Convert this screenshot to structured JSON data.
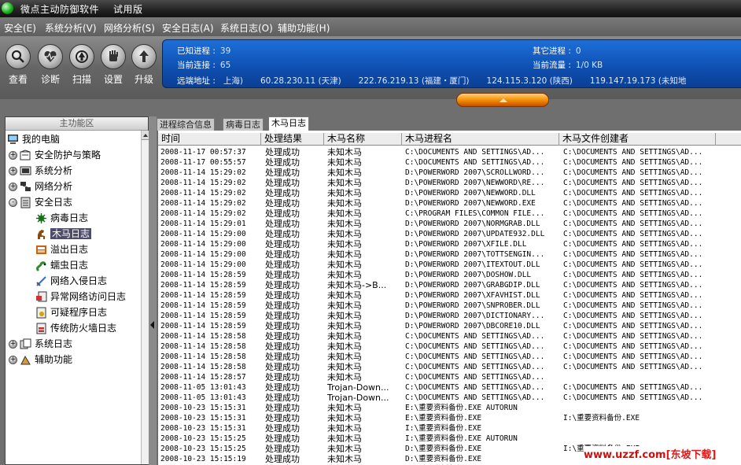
{
  "title": {
    "app_name": "微点主动防御软件",
    "edition": "试用版"
  },
  "menu": [
    "安全(E)",
    "系统分析(V)",
    "网络分析(S)",
    "安全日志(A)",
    "系统日志(O)",
    "辅助功能(H)"
  ],
  "toolbar": {
    "buttons": [
      {
        "label": "查看",
        "icon": "magnifier-icon"
      },
      {
        "label": "诊断",
        "icon": "heart-monitor-icon"
      },
      {
        "label": "扫描",
        "icon": "scan-icon"
      },
      {
        "label": "设置",
        "icon": "hand-icon"
      },
      {
        "label": "升级",
        "icon": "upgrade-icon"
      }
    ]
  },
  "info": {
    "known_processes_label": "已知进程 :",
    "known_processes": "39",
    "other_processes_label": "其它进程 :",
    "other_processes": "0",
    "connections_label": "当前连接 :",
    "connections": "65",
    "traffic_label": "当前流量 :",
    "traffic": "1/0 KB",
    "remote_label": "远端地址 :",
    "remote_addresses": [
      "上海)",
      "60.28.230.11 (天津)",
      "222.76.219.13 (福建・厦门)",
      "124.115.3.120 (陕西)",
      "119.147.19.173 (未知地"
    ]
  },
  "left_panel": {
    "header": "主功能区",
    "tree": [
      {
        "label": "我的电脑",
        "icon": "computer-icon",
        "level": 0,
        "expander": ""
      },
      {
        "label": "安全防护与策略",
        "icon": "shield-policy-icon",
        "level": 1,
        "expander": "+"
      },
      {
        "label": "系统分析",
        "icon": "system-icon",
        "level": 1,
        "expander": "+"
      },
      {
        "label": "网络分析",
        "icon": "network-icon",
        "level": 1,
        "expander": "+"
      },
      {
        "label": "安全日志",
        "icon": "log-icon",
        "level": 1,
        "expander": "-"
      },
      {
        "label": "病毒日志",
        "icon": "virus-icon",
        "level": 2,
        "expander": ""
      },
      {
        "label": "木马日志",
        "icon": "trojan-horse-icon",
        "level": 2,
        "expander": "",
        "selected": true
      },
      {
        "label": "溢出日志",
        "icon": "overflow-icon",
        "level": 2,
        "expander": ""
      },
      {
        "label": "蠕虫日志",
        "icon": "worm-icon",
        "level": 2,
        "expander": ""
      },
      {
        "label": "网络入侵日志",
        "icon": "sword-icon",
        "level": 2,
        "expander": ""
      },
      {
        "label": "异常网络访问日志",
        "icon": "network-log-icon",
        "level": 2,
        "expander": ""
      },
      {
        "label": "可疑程序日志",
        "icon": "suspicious-icon",
        "level": 2,
        "expander": ""
      },
      {
        "label": "传统防火墙日志",
        "icon": "firewall-icon",
        "level": 2,
        "expander": ""
      },
      {
        "label": "系统日志",
        "icon": "system-log-icon",
        "level": 1,
        "expander": "+"
      },
      {
        "label": "辅助功能",
        "icon": "tools-icon",
        "level": 1,
        "expander": "+"
      }
    ]
  },
  "tabs": [
    "进程综合信息",
    "病毒日志",
    "木马日志"
  ],
  "active_tab": 2,
  "table": {
    "columns": [
      "时间",
      "处理结果",
      "木马名称",
      "木马进程名",
      "木马文件创建者"
    ],
    "rows": [
      [
        "2008-11-17 00:57:37",
        "处理成功",
        "未知木马",
        "C:\\DOCUMENTS AND SETTINGS\\AD...",
        "C:\\DOCUMENTS AND SETTINGS\\AD..."
      ],
      [
        "2008-11-17 00:55:57",
        "处理成功",
        "未知木马",
        "C:\\DOCUMENTS AND SETTINGS\\AD...",
        "C:\\DOCUMENTS AND SETTINGS\\AD..."
      ],
      [
        "2008-11-14 15:29:02",
        "处理成功",
        "未知木马",
        "D:\\POWERWORD 2007\\SCROLLWORD...",
        "C:\\DOCUMENTS AND SETTINGS\\AD..."
      ],
      [
        "2008-11-14 15:29:02",
        "处理成功",
        "未知木马",
        "D:\\POWERWORD 2007\\NEWWORD\\RE...",
        "C:\\DOCUMENTS AND SETTINGS\\AD..."
      ],
      [
        "2008-11-14 15:29:02",
        "处理成功",
        "未知木马",
        "D:\\POWERWORD 2007\\NEWWORD.DLL",
        "C:\\DOCUMENTS AND SETTINGS\\AD..."
      ],
      [
        "2008-11-14 15:29:02",
        "处理成功",
        "未知木马",
        "D:\\POWERWORD 2007\\NEWWORD.EXE",
        "C:\\DOCUMENTS AND SETTINGS\\AD..."
      ],
      [
        "2008-11-14 15:29:02",
        "处理成功",
        "未知木马",
        "C:\\PROGRAM FILES\\COMMON FILE...",
        "C:\\DOCUMENTS AND SETTINGS\\AD..."
      ],
      [
        "2008-11-14 15:29:01",
        "处理成功",
        "未知木马",
        "D:\\POWERWORD 2007\\NORMGRAB.DLL",
        "C:\\DOCUMENTS AND SETTINGS\\AD..."
      ],
      [
        "2008-11-14 15:29:00",
        "处理成功",
        "未知木马",
        "D:\\POWERWORD 2007\\UPDATE932.DLL",
        "C:\\DOCUMENTS AND SETTINGS\\AD..."
      ],
      [
        "2008-11-14 15:29:00",
        "处理成功",
        "未知木马",
        "D:\\POWERWORD 2007\\XFILE.DLL",
        "C:\\DOCUMENTS AND SETTINGS\\AD..."
      ],
      [
        "2008-11-14 15:29:00",
        "处理成功",
        "未知木马",
        "D:\\POWERWORD 2007\\TOTTSENGIN...",
        "C:\\DOCUMENTS AND SETTINGS\\AD..."
      ],
      [
        "2008-11-14 15:29:00",
        "处理成功",
        "未知木马",
        "D:\\POWERWORD 2007\\ITEXTOUT.DLL",
        "C:\\DOCUMENTS AND SETTINGS\\AD..."
      ],
      [
        "2008-11-14 15:28:59",
        "处理成功",
        "未知木马",
        "D:\\POWERWORD 2007\\DOSHOW.DLL",
        "C:\\DOCUMENTS AND SETTINGS\\AD..."
      ],
      [
        "2008-11-14 15:28:59",
        "处理成功",
        "未知木马->B...",
        "D:\\POWERWORD 2007\\GRABGDIP.DLL",
        "C:\\DOCUMENTS AND SETTINGS\\AD..."
      ],
      [
        "2008-11-14 15:28:59",
        "处理成功",
        "未知木马",
        "D:\\POWERWORD 2007\\XFAVHIST.DLL",
        "C:\\DOCUMENTS AND SETTINGS\\AD..."
      ],
      [
        "2008-11-14 15:28:59",
        "处理成功",
        "未知木马",
        "D:\\POWERWORD 2007\\SNPROBER.DLL",
        "C:\\DOCUMENTS AND SETTINGS\\AD..."
      ],
      [
        "2008-11-14 15:28:59",
        "处理成功",
        "未知木马",
        "D:\\POWERWORD 2007\\DICTIONARY...",
        "C:\\DOCUMENTS AND SETTINGS\\AD..."
      ],
      [
        "2008-11-14 15:28:59",
        "处理成功",
        "未知木马",
        "D:\\POWERWORD 2007\\DBCORE10.DLL",
        "C:\\DOCUMENTS AND SETTINGS\\AD..."
      ],
      [
        "2008-11-14 15:28:58",
        "处理成功",
        "未知木马",
        "C:\\DOCUMENTS AND SETTINGS\\AD...",
        "C:\\DOCUMENTS AND SETTINGS\\AD..."
      ],
      [
        "2008-11-14 15:28:58",
        "处理成功",
        "未知木马",
        "C:\\DOCUMENTS AND SETTINGS\\AD...",
        "C:\\DOCUMENTS AND SETTINGS\\AD..."
      ],
      [
        "2008-11-14 15:28:58",
        "处理成功",
        "未知木马",
        "C:\\DOCUMENTS AND SETTINGS\\AD...",
        "C:\\DOCUMENTS AND SETTINGS\\AD..."
      ],
      [
        "2008-11-14 15:28:58",
        "处理成功",
        "未知木马",
        "C:\\DOCUMENTS AND SETTINGS\\AD...",
        "C:\\DOCUMENTS AND SETTINGS\\AD..."
      ],
      [
        "2008-11-14 15:28:57",
        "处理成功",
        "未知木马",
        "C:\\DOCUMENTS AND SETTINGS\\AD...",
        ""
      ],
      [
        "2008-11-05 13:01:43",
        "处理成功",
        "Trojan-Down...",
        "C:\\DOCUMENTS AND SETTINGS\\AD...",
        "C:\\DOCUMENTS AND SETTINGS\\AD..."
      ],
      [
        "2008-11-05 13:01:43",
        "处理成功",
        "Trojan-Down...",
        "C:\\DOCUMENTS AND SETTINGS\\AD...",
        "C:\\DOCUMENTS AND SETTINGS\\AD..."
      ],
      [
        "2008-10-23 15:15:31",
        "处理成功",
        "未知木马",
        "E:\\重要资料备份.EXE AUTORUN",
        ""
      ],
      [
        "2008-10-23 15:15:31",
        "处理成功",
        "未知木马",
        "E:\\重要资料备份.EXE",
        "I:\\重要资料备份.EXE"
      ],
      [
        "2008-10-23 15:15:31",
        "处理成功",
        "未知木马",
        "I:\\重要资料备份.EXE",
        ""
      ],
      [
        "2008-10-23 15:15:25",
        "处理成功",
        "未知木马",
        "I:\\重要资料备份.EXE AUTORUN",
        ""
      ],
      [
        "2008-10-23 15:15:25",
        "处理成功",
        "未知木马",
        "D:\\重要资料备份.EXE",
        "I:\\重要资料备份.EXE"
      ],
      [
        "2008-10-23 15:15:19",
        "处理成功",
        "未知木马",
        "D:\\重要资料备份.EXE",
        ""
      ],
      [
        "2008-10-23 15:15:17",
        "处理成功",
        "未知木马",
        "E:\\重要资料备份.EXE AUTORUN",
        ""
      ]
    ]
  },
  "watermark": {
    "url": "www.uzzf.com",
    "site": "[东坡下载]"
  }
}
